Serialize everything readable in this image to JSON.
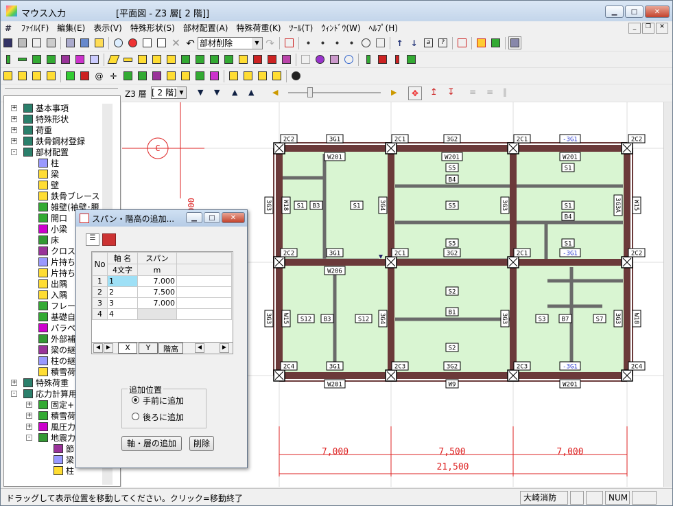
{
  "window": {
    "title": "マウス入力",
    "doc_title": "[平面図 - Z3  層[  2 階]]"
  },
  "menu": [
    "ﾌｧｲﾙ(F)",
    "編集(E)",
    "表示(V)",
    "特殊形状(S)",
    "部材配置(A)",
    "特殊荷重(K)",
    "ﾂｰﾙ(T)",
    "ｳｨﾝﾄﾞｳ(W)",
    "ﾍﾙﾌﾟ(H)"
  ],
  "toolbar": {
    "delete_combo": "部材削除"
  },
  "floor_bar": {
    "label": "Z3  層",
    "value": "[  2 階]"
  },
  "tree": {
    "items": [
      {
        "label": "基本事項",
        "level": 0,
        "exp": "+"
      },
      {
        "label": "特殊形状",
        "level": 0,
        "exp": "+"
      },
      {
        "label": "荷重",
        "level": 0,
        "exp": "+"
      },
      {
        "label": "鉄骨鋼材登録",
        "level": 0,
        "exp": "+"
      },
      {
        "label": "部材配置",
        "level": 0,
        "exp": "-"
      },
      {
        "label": "柱",
        "level": 1
      },
      {
        "label": "梁",
        "level": 1
      },
      {
        "label": "壁",
        "level": 1
      },
      {
        "label": "鉄骨ブレース",
        "level": 1
      },
      {
        "label": "雑壁(袖壁･腰",
        "level": 1
      },
      {
        "label": "開口",
        "level": 1
      },
      {
        "label": "小梁",
        "level": 1
      },
      {
        "label": "床",
        "level": 1
      },
      {
        "label": "クロス",
        "level": 1
      },
      {
        "label": "片持ち",
        "level": 1
      },
      {
        "label": "片持ち",
        "level": 1
      },
      {
        "label": "出隅",
        "level": 1
      },
      {
        "label": "入隅",
        "level": 1
      },
      {
        "label": "フレー",
        "level": 1
      },
      {
        "label": "基礎自",
        "level": 1
      },
      {
        "label": "パラペ",
        "level": 1
      },
      {
        "label": "外部補",
        "level": 1
      },
      {
        "label": "梁の継",
        "level": 1
      },
      {
        "label": "柱の継",
        "level": 1
      },
      {
        "label": "積雪荷",
        "level": 1
      },
      {
        "label": "特殊荷重",
        "level": 0,
        "exp": "+"
      },
      {
        "label": "応力計算用",
        "level": 0,
        "exp": "-"
      },
      {
        "label": "固定+",
        "level": 1,
        "exp": "+"
      },
      {
        "label": "積雪荷",
        "level": 1,
        "exp": "+"
      },
      {
        "label": "風圧力",
        "level": 1,
        "exp": "+"
      },
      {
        "label": "地震力",
        "level": 1,
        "exp": "-"
      },
      {
        "label": "節",
        "level": 2
      },
      {
        "label": "梁",
        "level": 2
      },
      {
        "label": "柱",
        "level": 2
      }
    ]
  },
  "dialog": {
    "title": "スパン・階高の追加...",
    "columns": [
      "No",
      "軸 名",
      "スパン"
    ],
    "subheaders": [
      "",
      "4文字",
      "m"
    ],
    "rows": [
      {
        "no": "1",
        "name": "1",
        "span": "7.000"
      },
      {
        "no": "2",
        "name": "2",
        "span": "7.500"
      },
      {
        "no": "3",
        "name": "3",
        "span": "7.000"
      },
      {
        "no": "4",
        "name": "4",
        "span": ""
      }
    ],
    "tabs": [
      "X",
      "Y",
      "階高"
    ],
    "group_label": "追加位置",
    "radio_front": "手前に追加",
    "radio_back": "後ろに追加",
    "add_button": "軸・層の追加",
    "delete_button": "削除"
  },
  "plan": {
    "axis_label": "C",
    "dim_small": "000",
    "top_cols": [
      "2C2",
      "2C1",
      "2C1",
      "2C2"
    ],
    "mid_cols": [
      "2C2",
      "2C1",
      "2C1",
      "2C2"
    ],
    "bot_cols": [
      "2C4",
      "2C3",
      "2C3",
      "2C4"
    ],
    "top_beams": [
      "3G1",
      "3G2",
      "-3G1"
    ],
    "mid_beams": [
      "3G1",
      "3G2",
      "-3G1"
    ],
    "bot_beams": [
      "3G1",
      "3G2",
      "-3G1"
    ],
    "top_walls": [
      "W201",
      "W201",
      "W201"
    ],
    "mid_wall": "W206",
    "bot_walls": [
      "W201",
      "W9",
      "W201"
    ],
    "dims": [
      "7,000",
      "7,500",
      "7,000"
    ],
    "dim_total": "21,500",
    "slab_labels": [
      "S1",
      "S1",
      "S1",
      "S1",
      "S5",
      "S5",
      "S5",
      "S1",
      "S12",
      "S12",
      "S2",
      "S2",
      "S3",
      "S7"
    ],
    "small_beams": [
      "B3",
      "B4",
      "B4",
      "B1",
      "B3",
      "B7"
    ],
    "v_beam_labels": [
      "3G3",
      "3G4",
      "3G3",
      "3G3A",
      "3G3",
      "3G4",
      "3G3",
      "3G3"
    ],
    "v_wall_labels": [
      "W18",
      "W15",
      "W15",
      "W18"
    ]
  },
  "status": {
    "message": "ドラッグして表示位置を移動してください。クリック=移動終了",
    "user": "大崎消防",
    "num": "NUM"
  }
}
